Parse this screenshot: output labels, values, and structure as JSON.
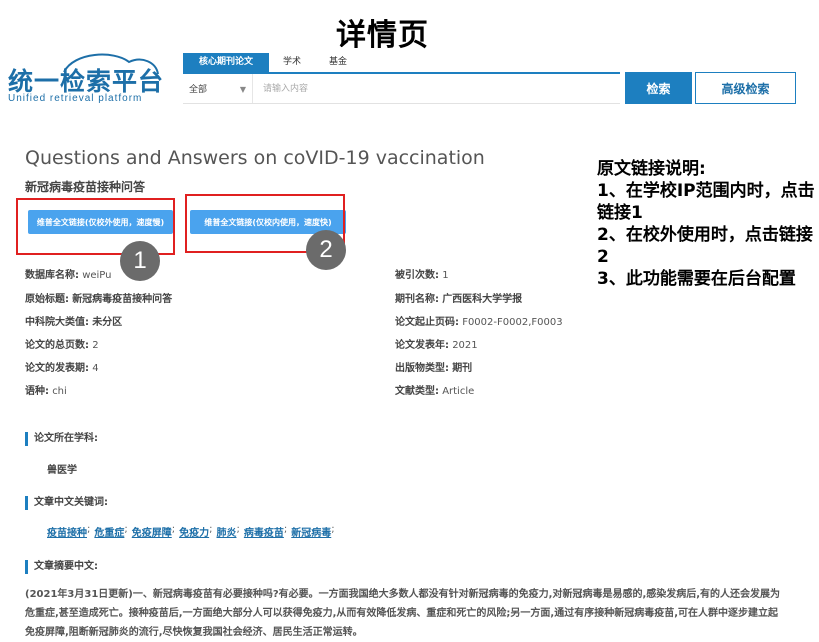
{
  "page_heading": "详情页",
  "logo": {
    "title": "统一检索平台",
    "subtitle": "Unified retrieval platform"
  },
  "search": {
    "tabs": [
      {
        "label": "核心期刊论文",
        "active": true
      },
      {
        "label": "学术",
        "active": false
      },
      {
        "label": "基金",
        "active": false
      }
    ],
    "scope": "全部",
    "placeholder": "请输入内容",
    "search_label": "检索",
    "advanced_label": "高级检索"
  },
  "article": {
    "title_en": "Questions and Answers on coVID-19 vaccination",
    "title_cn": "新冠病毒疫苗接种问答",
    "link1_label": "维普全文链接(仅校外使用，速度慢)",
    "link2_label": "维普全文链接(仅校内使用，速度快)",
    "marker1": "1",
    "marker2": "2"
  },
  "note": {
    "title": "原文链接说明:",
    "line1": "1、在学校IP范围内时，点击链接1",
    "line2": "2、在校外使用时，点击链接2",
    "line3": "3、此功能需要在后台配置"
  },
  "meta_left": [
    {
      "key": "数据库名称:",
      "value": "weiPu"
    },
    {
      "key": "原始标题:",
      "value": "新冠病毒疫苗接种问答"
    },
    {
      "key": "中科院大类值:",
      "value": "未分区"
    },
    {
      "key": "论文的总页数:",
      "value": "2"
    },
    {
      "key": "论文的发表期:",
      "value": "4"
    },
    {
      "key": "语种:",
      "value": "chi"
    }
  ],
  "meta_right": [
    {
      "key": "被引次数:",
      "value": "1"
    },
    {
      "key": "期刊名称:",
      "value": "广西医科大学学报"
    },
    {
      "key": "论文起止页码:",
      "value": "F0002-F0002,F0003"
    },
    {
      "key": "论文发表年:",
      "value": "2021"
    },
    {
      "key": "出版物类型:",
      "value": "期刊"
    },
    {
      "key": "文献类型:",
      "value": "Article"
    }
  ],
  "sections": {
    "subject_head": "论文所在学科:",
    "subject_value": "兽医学",
    "keywords_head": "文章中文关键词:",
    "keywords": [
      "疫苗接种",
      "危重症",
      "免疫屏障",
      "免疫力",
      "肺炎",
      "病毒疫苗",
      "新冠病毒"
    ],
    "abstract_head": "文章摘要中文:",
    "abstract": "(2021年3月31日更新)一、新冠病毒疫苗有必要接种吗?有必要。一方面我国绝大多数人都没有针对新冠病毒的免疫力,对新冠病毒是易感的,感染发病后,有的人还会发展为危重症,甚至造成死亡。接种疫苗后,一方面绝大部分人可以获得免疫力,从而有效降低发病、重症和死亡的风险;另一方面,通过有序接种新冠病毒疫苗,可在人群中逐步建立起免疫屏障,阻断新冠肺炎的流行,尽快恢复我国社会经济、居民生活正常运转。"
  }
}
